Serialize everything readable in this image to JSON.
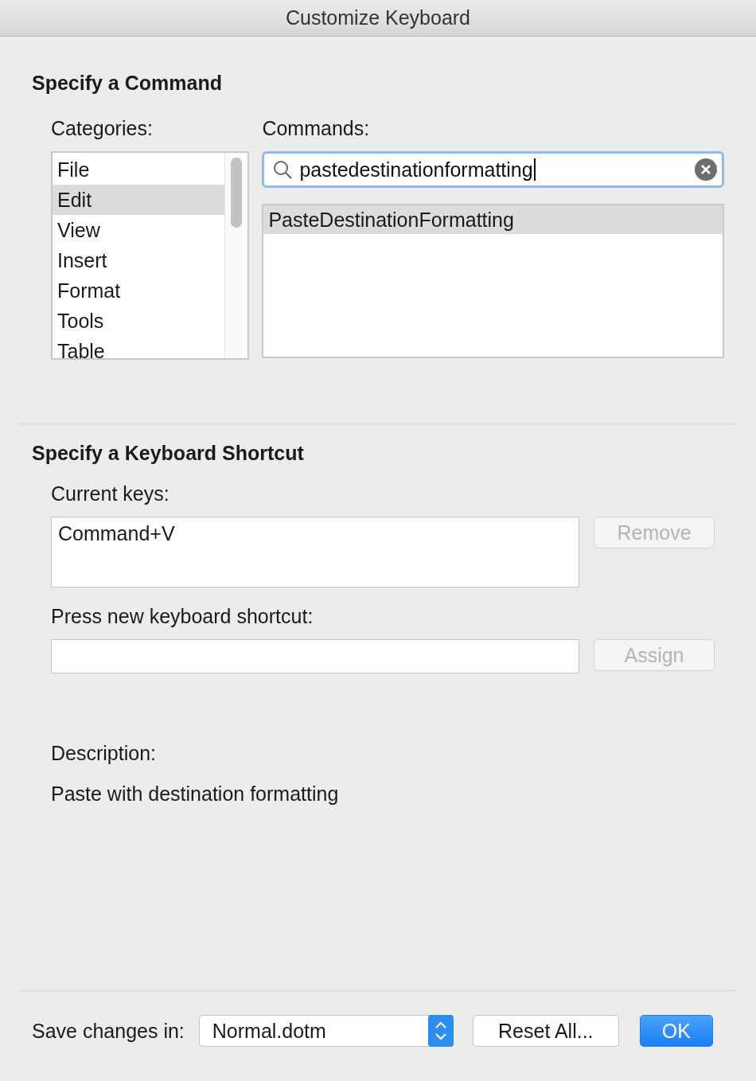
{
  "window": {
    "title": "Customize Keyboard"
  },
  "command_section": {
    "heading": "Specify a Command",
    "categories_label": "Categories:",
    "categories": [
      {
        "label": "File",
        "selected": false
      },
      {
        "label": "Edit",
        "selected": true
      },
      {
        "label": "View",
        "selected": false
      },
      {
        "label": "Insert",
        "selected": false
      },
      {
        "label": "Format",
        "selected": false
      },
      {
        "label": "Tools",
        "selected": false
      },
      {
        "label": "Table",
        "selected": false
      }
    ],
    "commands_label": "Commands:",
    "search": {
      "value": "pastedestinationformatting"
    },
    "commands": [
      {
        "label": "PasteDestinationFormatting",
        "selected": true
      }
    ]
  },
  "shortcut_section": {
    "heading": "Specify a Keyboard Shortcut",
    "current_keys_label": "Current keys:",
    "current_keys": [
      "Command+V"
    ],
    "remove_button": {
      "label": "Remove",
      "disabled": true
    },
    "new_shortcut_label": "Press new keyboard shortcut:",
    "assign_button": {
      "label": "Assign",
      "disabled": true
    },
    "description_label": "Description:",
    "description": "Paste with destination formatting"
  },
  "footer": {
    "save_label": "Save changes in:",
    "save_in": "Normal.dotm",
    "reset_button": "Reset All...",
    "ok_button": "OK"
  }
}
